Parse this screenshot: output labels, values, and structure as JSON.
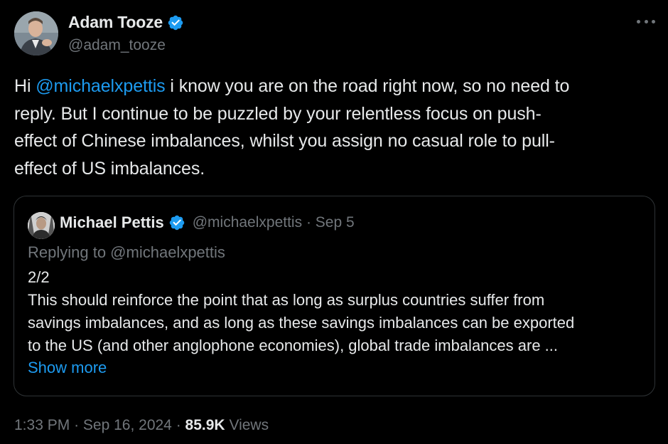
{
  "author": {
    "display_name": "Adam Tooze",
    "handle": "@adam_tooze",
    "verified_color": "#1d9bf0"
  },
  "menu_icon": "more-horizontal-icon",
  "tweet": {
    "lines": [
      {
        "mention": "@michaelxpettis",
        "before": "Hi ",
        "after": " i know you are on the road right now, so no need to"
      },
      {
        "text": "reply. But I continue to be puzzled by your relentless focus on push-"
      },
      {
        "text": "effect of Chinese imbalances, whilst you assign no casual role to pull-"
      },
      {
        "text": "effect of US imbalances."
      }
    ]
  },
  "quote": {
    "display_name": "Michael Pettis",
    "handle": "@michaelxpettis",
    "separator": "·",
    "date": "Sep 5",
    "replying_to": "Replying to @michaelxpettis",
    "lines": [
      "2/2",
      "This should reinforce the point that as long as surplus countries suffer from",
      "savings imbalances, and as long as these savings imbalances can be exported",
      "to the US (and other anglophone economies), global trade imbalances are ..."
    ],
    "show_more": "Show more"
  },
  "footer": {
    "time": "1:33 PM",
    "separator1": "·",
    "date": "Sep 16, 2024",
    "separator2": "·",
    "views_count": "85.9K",
    "views_label": "Views"
  },
  "colors": {
    "background": "#000000",
    "text": "#e7e9ea",
    "muted": "#71767b",
    "link": "#1d9bf0",
    "border": "#2f3336"
  }
}
